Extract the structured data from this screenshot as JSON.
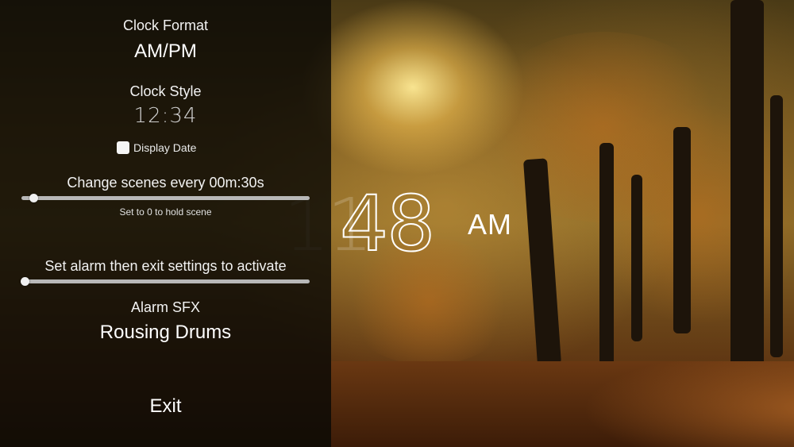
{
  "settings": {
    "clock_format": {
      "label": "Clock Format",
      "value": "AM/PM"
    },
    "clock_style": {
      "label": "Clock Style",
      "preview": "12:34"
    },
    "display_date": {
      "label": "Display Date",
      "checked": true
    },
    "scene_change": {
      "label": "Change scenes every 00m:30s",
      "hint": "Set to 0 to hold scene",
      "slider_level_percent": 4
    },
    "alarm": {
      "label": "Set alarm then exit settings to activate",
      "slider_level_percent": 0
    },
    "alarm_sfx": {
      "label": "Alarm SFX",
      "value": "Rousing Drums"
    },
    "exit_label": "Exit"
  },
  "clock": {
    "hours": "11",
    "minutes": "48",
    "ampm": "AM"
  }
}
